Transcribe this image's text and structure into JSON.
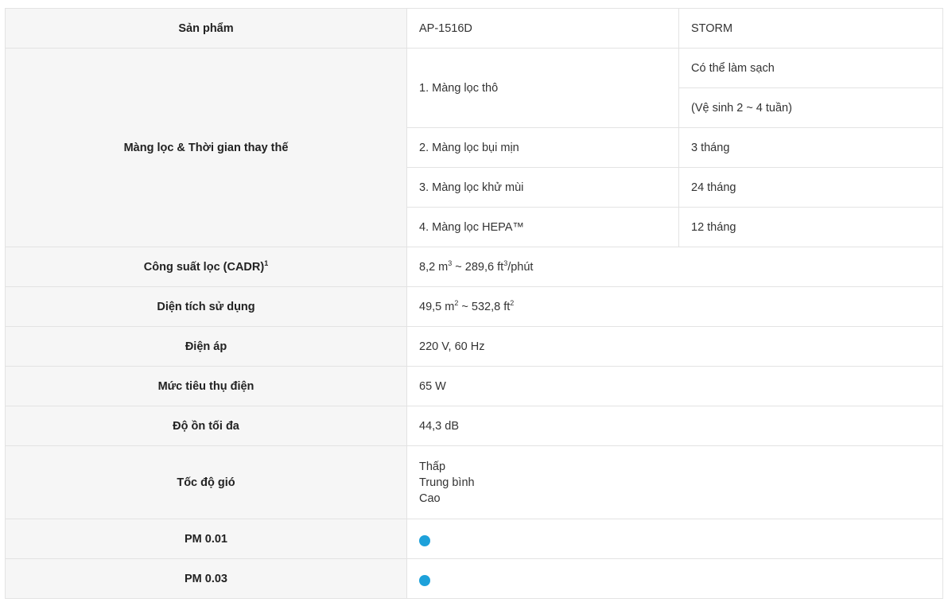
{
  "colors": {
    "label_bg": "#f6f6f6",
    "border": "#e3e3e3",
    "dot": "#1ea1da"
  },
  "rows": {
    "product": {
      "label": "Sản phẩm",
      "model_a": "AP-1516D",
      "model_b": "STORM"
    },
    "filters": {
      "label": "Màng lọc & Thời gian thay thế",
      "items": [
        {
          "name": "1. Màng lọc thô",
          "time": [
            "Có thể làm sạch",
            "(Vệ sinh 2 ~ 4 tuần)"
          ]
        },
        {
          "name": "2. Màng lọc bụi mịn",
          "time": [
            "3 tháng"
          ]
        },
        {
          "name": "3. Màng lọc khử mùi",
          "time": [
            "24 tháng"
          ]
        },
        {
          "name": "4. Màng lọc HEPA™",
          "time": [
            "12 tháng"
          ]
        }
      ]
    },
    "cadr": {
      "label": "Công suất lọc (CADR)",
      "label_sup": "1",
      "v1": "8,2 m",
      "v1_sup": "3",
      "v2": " ~ 289,6 ft",
      "v2_sup": "3",
      "v3": "/phút"
    },
    "area": {
      "label": "Diện tích sử dụng",
      "v1": "49,5 m",
      "v1_sup": "2",
      "v2": " ~ 532,8 ft",
      "v2_sup": "2"
    },
    "voltage": {
      "label": "Điện áp",
      "value": "220 V, 60 Hz"
    },
    "power": {
      "label": "Mức tiêu thụ điện",
      "value": "65 W"
    },
    "noise": {
      "label": "Độ ồn tối đa",
      "value": "44,3 dB"
    },
    "fan": {
      "label": "Tốc độ gió",
      "values": [
        "Thấp",
        "Trung bình",
        "Cao"
      ]
    },
    "pm001": {
      "label": "PM 0.01",
      "supported": true,
      "icon": "filled-circle-icon"
    },
    "pm003": {
      "label": "PM 0.03",
      "supported": true,
      "icon": "filled-circle-icon"
    }
  }
}
